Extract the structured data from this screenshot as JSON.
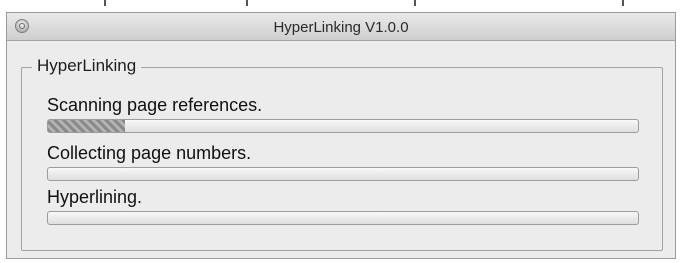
{
  "window": {
    "title": "HyperLinking V1.0.0"
  },
  "group": {
    "label": "HyperLinking"
  },
  "steps": [
    {
      "label": "Scanning page references.",
      "progress": 0.13
    },
    {
      "label": "Collecting page numbers.",
      "progress": 0
    },
    {
      "label": "Hyperlining.",
      "progress": 0
    }
  ],
  "icons": {
    "close": "close-button-icon"
  }
}
